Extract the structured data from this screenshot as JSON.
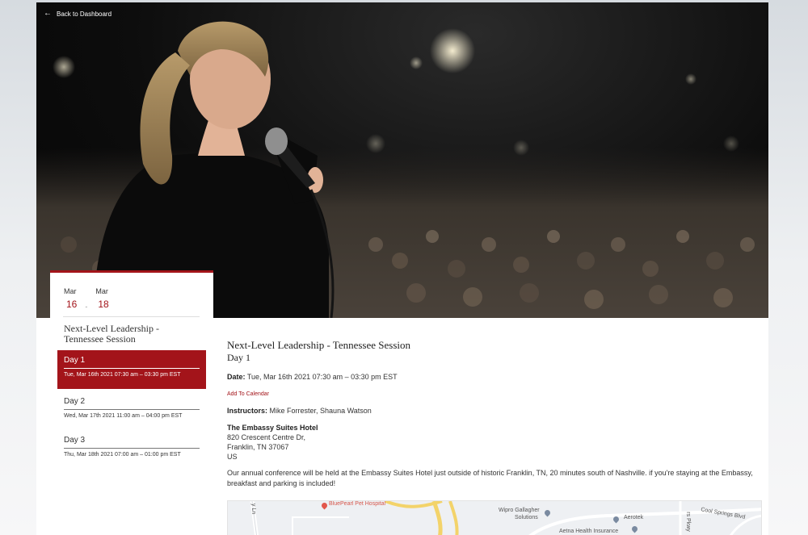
{
  "nav": {
    "back_label": "Back to Dashboard"
  },
  "date_range": {
    "start_month": "Mar",
    "start_day": "16",
    "separator": "-",
    "end_month": "Mar",
    "end_day": "18"
  },
  "sidebar": {
    "event_title": "Next-Level Leadership - Tennessee Session",
    "days": [
      {
        "label": "Day 1",
        "time": "Tue, Mar 16th 2021 07:30 am – 03:30 pm EST",
        "active": true
      },
      {
        "label": "Day 2",
        "time": "Wed, Mar 17th 2021 11:00 am – 04:00 pm EST",
        "active": false
      },
      {
        "label": "Day 3",
        "time": "Thu, Mar 18th 2021 07:00 am – 01:00 pm EST",
        "active": false
      }
    ]
  },
  "content": {
    "title": "Next-Level Leadership - Tennessee Session",
    "subtitle": "Day 1",
    "date_label": "Date:",
    "date_value": "Tue, Mar 16th 2021 07:30 am – 03:30 pm EST",
    "add_calendar": "Add To Calendar",
    "instructors_label": "Instructors:",
    "instructors_value": "Mike Forrester, Shauna Watson",
    "venue": "The Embassy Suites Hotel",
    "address_line1": "820 Crescent Centre Dr,",
    "address_line2": "Franklin, TN 37067",
    "address_line3": "US",
    "description": "Our annual conference will be held at the Embassy Suites Hotel just outside of historic Franklin, TN, 20 minutes south of Nashville. if you're staying at the Embassy, breakfast and parking is included!"
  },
  "map": {
    "labels": {
      "bluepearl": "BluePearl Pet Hospital",
      "wipro": "Wipro Gallagher",
      "wipro2": "Solutions",
      "aerotek": "Aerotek",
      "aetna": "Aetna Health Insurance",
      "cool_springs": "Cool Springs Blvd",
      "y_ln": "y Ln",
      "rs_pkwy": "rs Pkwy"
    }
  },
  "colors": {
    "accent": "#a3141a"
  }
}
